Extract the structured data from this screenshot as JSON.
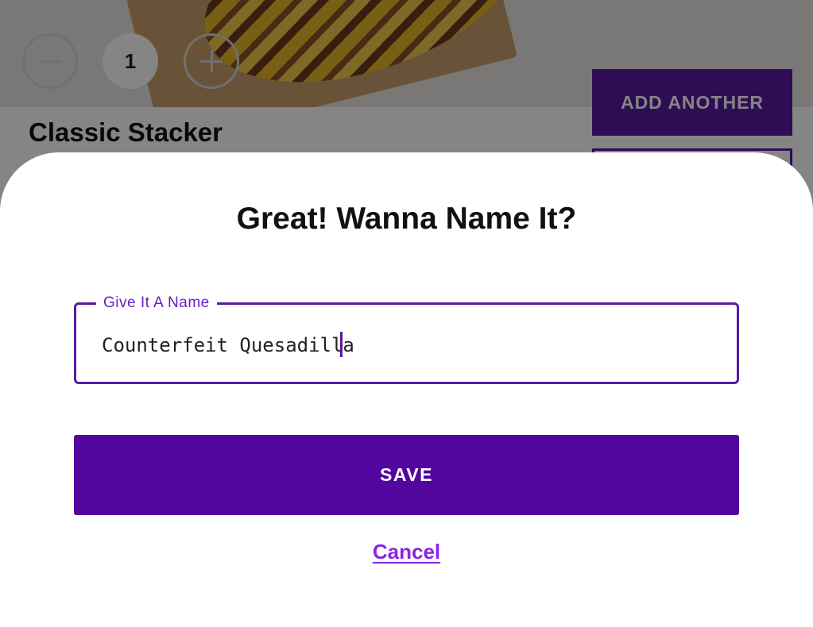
{
  "background": {
    "quantity": {
      "value": "1"
    },
    "product": {
      "title": "Classic Stacker"
    },
    "actions": {
      "add_another_label": "ADD ANOTHER"
    }
  },
  "dialog": {
    "title": "Great! Wanna Name It?",
    "name_field": {
      "label": "Give It A Name",
      "value": "Counterfeit Quesadilla"
    },
    "save_label": "SAVE",
    "cancel_label": "Cancel"
  },
  "colors": {
    "primary_purple": "#52069e",
    "accent_purple": "#8a24e0",
    "field_border": "#5a1aa3"
  },
  "icons": [
    "minus-icon",
    "plus-icon"
  ]
}
